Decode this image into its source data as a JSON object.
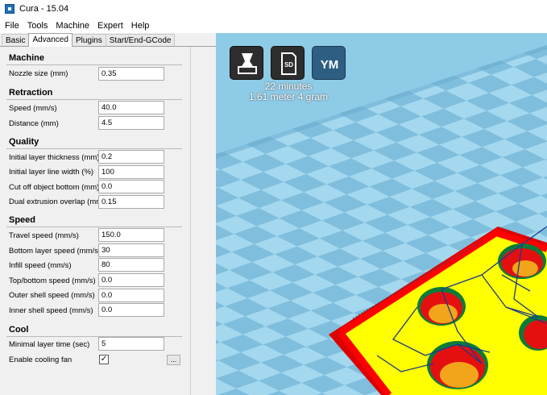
{
  "window": {
    "title": "Cura - 15.04"
  },
  "menu": [
    "File",
    "Tools",
    "Machine",
    "Expert",
    "Help"
  ],
  "tabs": [
    {
      "label": "Basic",
      "active": false
    },
    {
      "label": "Advanced",
      "active": true
    },
    {
      "label": "Plugins",
      "active": false
    },
    {
      "label": "Start/End-GCode",
      "active": false
    }
  ],
  "machine": {
    "title": "Machine",
    "nozzle_label": "Nozzle size (mm)",
    "nozzle_value": "0.35"
  },
  "retraction": {
    "title": "Retraction",
    "speed_label": "Speed (mm/s)",
    "speed_value": "40.0",
    "distance_label": "Distance (mm)",
    "distance_value": "4.5"
  },
  "quality": {
    "title": "Quality",
    "layer_thickness_label": "Initial layer thickness (mm)",
    "layer_thickness_value": "0.2",
    "line_width_label": "Initial layer line width (%)",
    "line_width_value": "100",
    "cut_off_label": "Cut off object bottom (mm)",
    "cut_off_value": "0.0",
    "dual_overlap_label": "Dual extrusion overlap (mm)",
    "dual_overlap_value": "0.15"
  },
  "speed": {
    "title": "Speed",
    "travel_label": "Travel speed (mm/s)",
    "travel_value": "150.0",
    "bottom_label": "Bottom layer speed (mm/s)",
    "bottom_value": "30",
    "infill_label": "Infill speed (mm/s)",
    "infill_value": "80",
    "topbottom_label": "Top/bottom speed (mm/s)",
    "topbottom_value": "0.0",
    "outer_label": "Outer shell speed (mm/s)",
    "outer_value": "0.0",
    "inner_label": "Inner shell speed (mm/s)",
    "inner_value": "0.0"
  },
  "cool": {
    "title": "Cool",
    "min_layer_label": "Minimal layer time (sec)",
    "min_layer_value": "5",
    "fan_label": "Enable cooling fan",
    "fan_checked": "✓",
    "fan_more": "..."
  },
  "viewport": {
    "sd_label": "SD",
    "ym_label": "YM",
    "time_text": "22 minutes",
    "material_text": "1.61 meter 4 gram"
  },
  "colors": {
    "floor_light": "#9fd6ee",
    "floor_dark": "#78b9d8",
    "model_top": "#ffff00",
    "model_edge": "#ff0000",
    "path_lines": "#1a3a8a",
    "button_dark": "#2d2d2d",
    "button_blue": "#2e5f83"
  }
}
